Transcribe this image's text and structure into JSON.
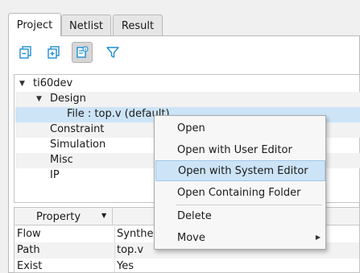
{
  "tabs": [
    {
      "label": "Project",
      "active": true
    },
    {
      "label": "Netlist",
      "active": false
    },
    {
      "label": "Result",
      "active": false
    }
  ],
  "toolbar": {
    "icons": [
      "collapse-all-icon",
      "expand-all-icon",
      "project-info-icon",
      "filter-icon"
    ],
    "accent": "#1e8fd0"
  },
  "tree": {
    "root": "ti60dev",
    "design": "Design",
    "file": "File : top.v (default)",
    "constraint": "Constraint",
    "simulation": "Simulation",
    "misc": "Misc",
    "ip": "IP"
  },
  "properties": {
    "header": "Property",
    "rows": [
      {
        "key": "Flow",
        "value": "Synthes"
      },
      {
        "key": "Path",
        "value": "top.v"
      },
      {
        "key": "Exist",
        "value": "Yes"
      }
    ]
  },
  "context_menu": {
    "items": [
      {
        "label": "Open"
      },
      {
        "label": "Open with User Editor"
      },
      {
        "label": "Open with System Editor",
        "highlighted": true
      },
      {
        "label": "Open Containing Folder"
      },
      {
        "label": "Delete"
      },
      {
        "label": "Move",
        "submenu": true
      }
    ]
  },
  "colors": {
    "selection": "#cde4f7",
    "icon_blue": "#1e8fd0"
  }
}
